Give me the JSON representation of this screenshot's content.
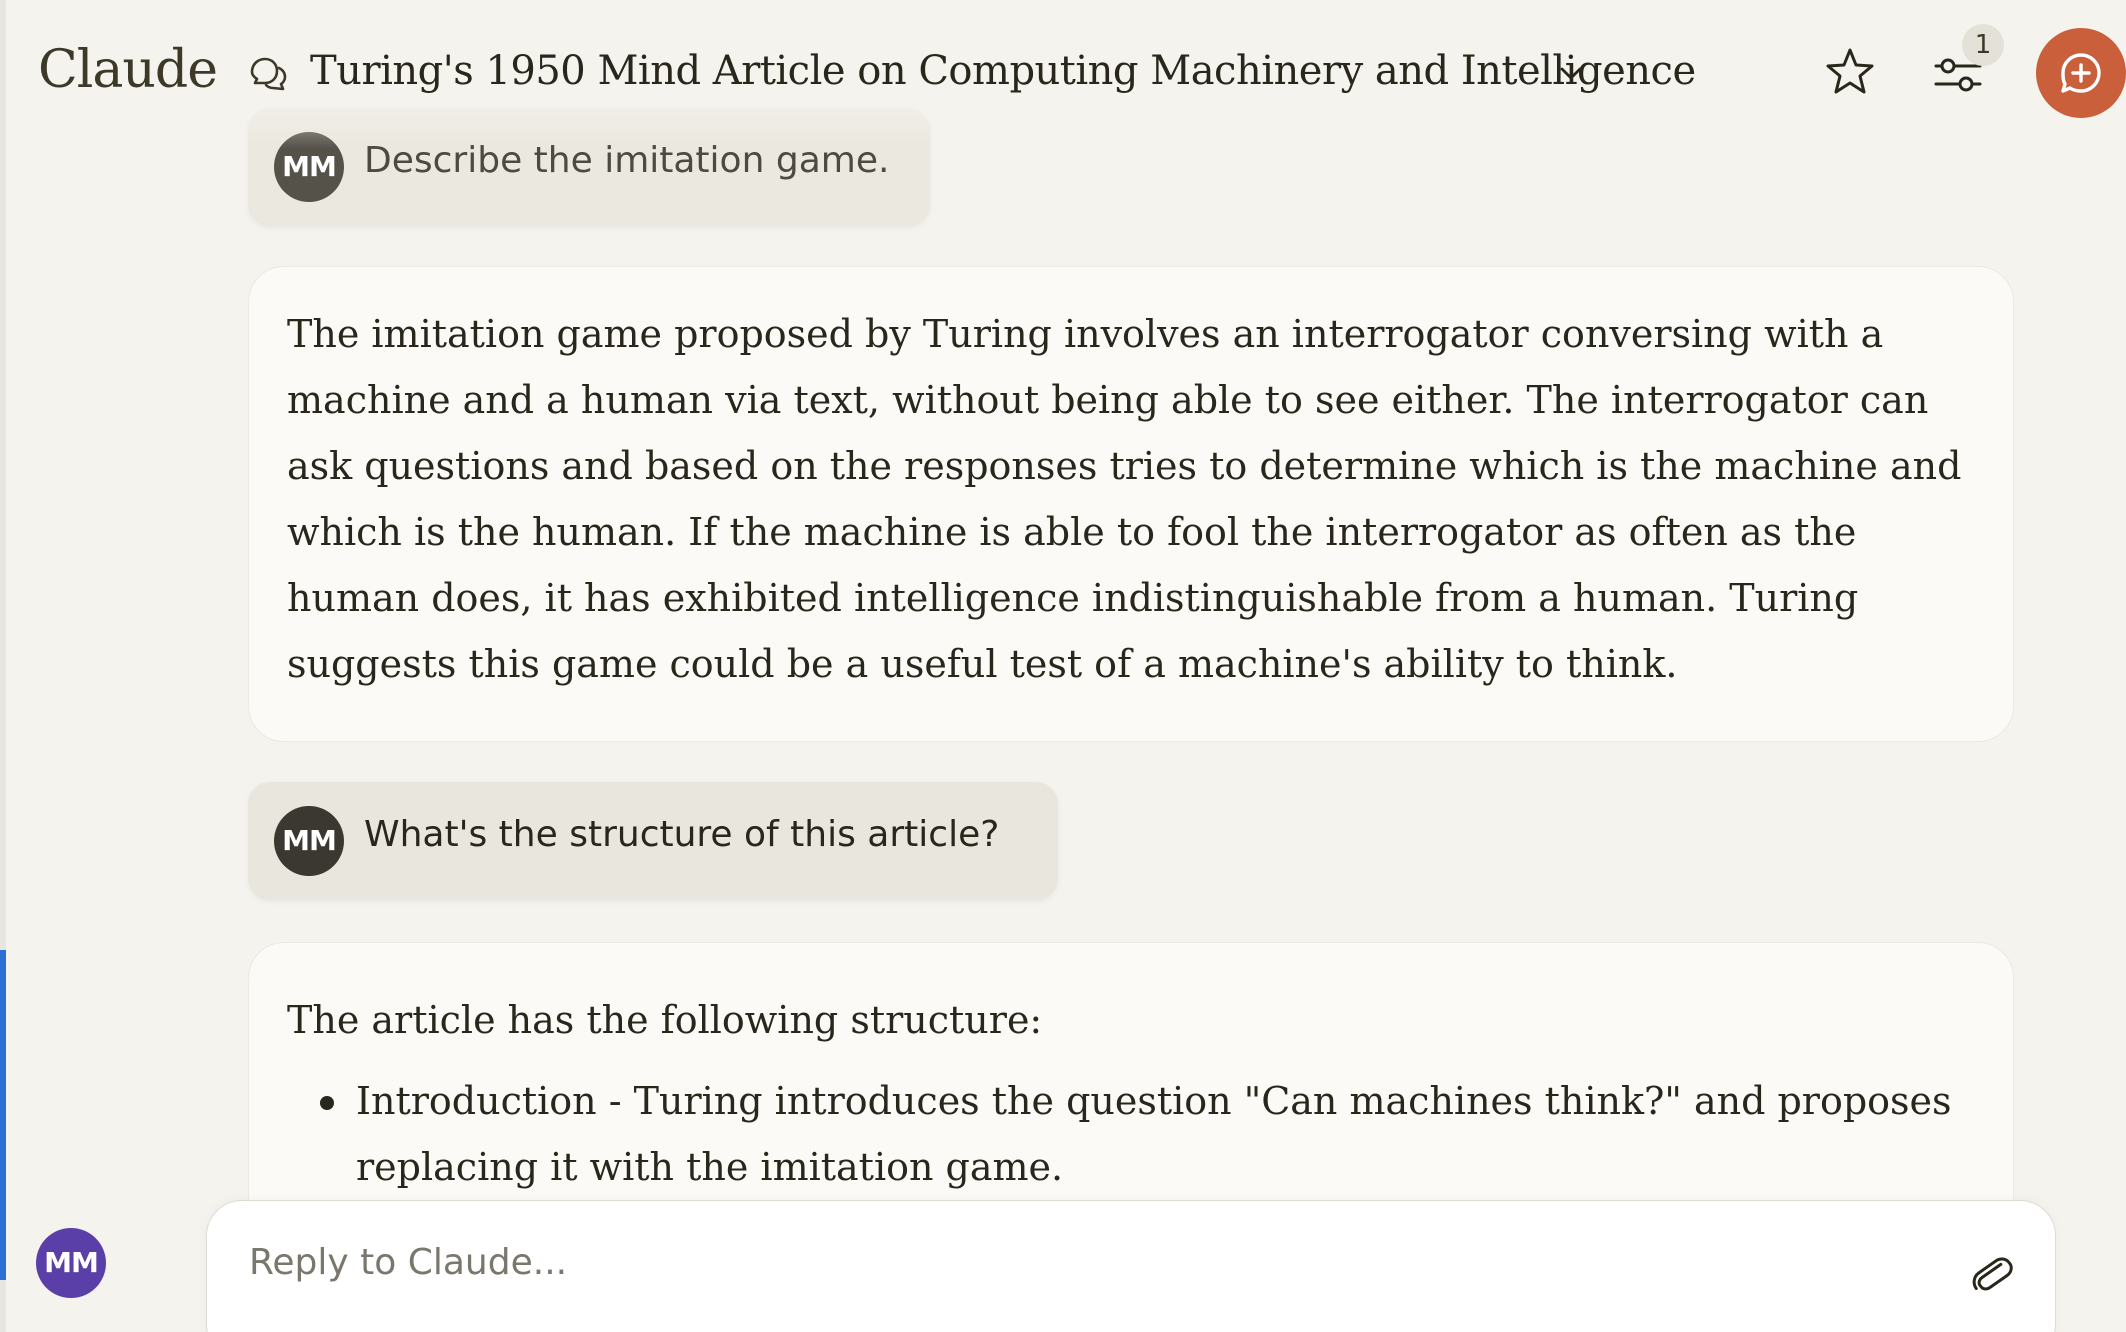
{
  "header": {
    "logo": "Claude",
    "conversation_title": "Turing's 1950 Mind Article on Computing Machinery and Intelligence",
    "settings_badge_count": "1"
  },
  "messages": [
    {
      "role": "user",
      "avatar_initials": "MM",
      "text": "Describe the imitation game."
    },
    {
      "role": "assistant",
      "paragraphs": [
        "The imitation game proposed by Turing involves an interrogator conversing with a machine and a human via text, without being able to see either. The interrogator can ask questions and based on the responses tries to determine which is the machine and which is the human. If the machine is able to fool the interrogator as often as the human does, it has exhibited intelligence indistinguishable from a human. Turing suggests this game could be a useful test of a machine's ability to think."
      ]
    },
    {
      "role": "user",
      "avatar_initials": "MM",
      "text": "What's the structure of this article?"
    },
    {
      "role": "assistant",
      "intro": "The article has the following structure:",
      "bullets": [
        "Introduction - Turing introduces the question \"Can machines think?\" and proposes replacing it with the imitation game."
      ]
    }
  ],
  "composer": {
    "placeholder": "Reply to Claude...",
    "user_avatar_initials": "MM"
  },
  "colors": {
    "background": "#f5f3ee",
    "accent": "#c95f3b",
    "user_avatar": "#5b3fa8"
  },
  "icons": {
    "conversation": "chat-bubbles-icon",
    "title_dropdown": "chevron-down-icon",
    "star": "star-icon",
    "settings": "sliders-icon",
    "new_chat": "chat-plus-icon",
    "attach": "paperclip-icon"
  }
}
